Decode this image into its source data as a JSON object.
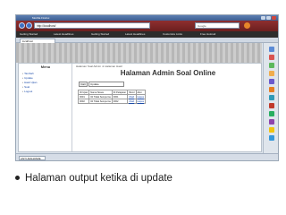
{
  "browser": {
    "title": "Mozilla Firefox",
    "url": "http://localhost/",
    "search_placeholder": "Google",
    "bookmarks": [
      "Getting Started",
      "Latest Headlines",
      "Getting Started",
      "Latest Headlines",
      "Customize Links",
      "Free Hotmail"
    ],
    "tab_label": "localhost",
    "status_field": "ANTI-MALWARE"
  },
  "page": {
    "breadcrumb": "Halaman Soal Admin ➔ Halaman Hasil",
    "heading": "Halaman Admin Soal Online",
    "menu_title": "Menu",
    "menu_items": [
      "Tambah",
      "Update",
      "Hasil Ujian",
      "Soal",
      "Logout"
    ],
    "search_button": "Cari",
    "search_value": "Update",
    "table": {
      "headers": [
        "ID Ujian",
        "Nama Siswa",
        "ID Pelajaran",
        "NILAI",
        "Aksi"
      ],
      "rows": [
        [
          "0001",
          "02 Tidak Sempurna",
          "0001",
          "Ubah",
          "Hapus"
        ],
        [
          "0002",
          "02 Tidak Sempurna",
          "0002",
          "Ubah",
          "Hapus"
        ]
      ]
    }
  },
  "caption": "Halaman output ketika di update"
}
